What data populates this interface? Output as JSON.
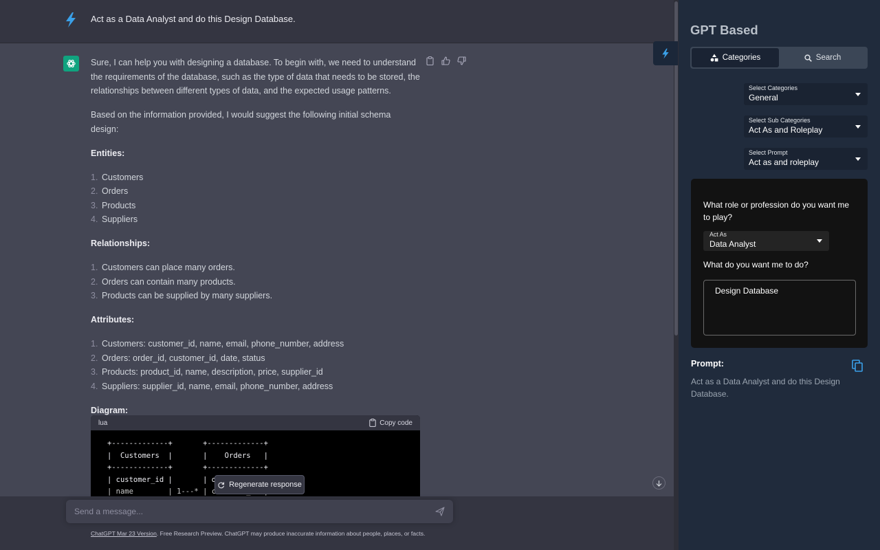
{
  "user_message": {
    "text": "Act as a Data Analyst and do this Design Database."
  },
  "assistant": {
    "intro": "Sure, I can help you with designing a database. To begin with, we need to understand the requirements of the database, such as the type of data that needs to be stored, the relationships between different types of data, and the expected usage patterns.",
    "suggestion": "Based on the information provided, I would suggest the following initial schema design:",
    "entities_heading": "Entities:",
    "entities": [
      {
        "num": "1.",
        "text": "Customers"
      },
      {
        "num": "2.",
        "text": "Orders"
      },
      {
        "num": "3.",
        "text": "Products"
      },
      {
        "num": "4.",
        "text": "Suppliers"
      }
    ],
    "relationships_heading": "Relationships:",
    "relationships": [
      {
        "num": "1.",
        "text": "Customers can place many orders."
      },
      {
        "num": "2.",
        "text": "Orders can contain many products."
      },
      {
        "num": "3.",
        "text": "Products can be supplied by many suppliers."
      }
    ],
    "attributes_heading": "Attributes:",
    "attributes": [
      {
        "num": "1.",
        "text": "Customers: customer_id, name, email, phone_number, address"
      },
      {
        "num": "2.",
        "text": "Orders: order_id, customer_id, date, status"
      },
      {
        "num": "3.",
        "text": "Products: product_id, name, description, price, supplier_id"
      },
      {
        "num": "4.",
        "text": "Suppliers: supplier_id, name, email, phone_number, address"
      }
    ],
    "diagram_heading": "Diagram:",
    "code": {
      "language": "lua",
      "copy_label": "Copy code",
      "lines": [
        "+-------------+       +-------------+",
        "|  Customers  |       |    Orders   |",
        "+-------------+       +-------------+",
        "| customer_id |       | o",
        "| name        | 1---* | customer_id |"
      ]
    }
  },
  "regenerate_label": "Regenerate response",
  "input": {
    "placeholder": "Send a message..."
  },
  "footer": {
    "link": "ChatGPT Mar 23 Version",
    "text": ". Free Research Preview. ChatGPT may produce inaccurate information about people, places, or facts."
  },
  "sidebar": {
    "title": "GPT Based",
    "tabs": [
      {
        "label": "Categories",
        "icon": "shapes-icon",
        "active": true
      },
      {
        "label": "Search",
        "icon": "search-icon",
        "active": false
      }
    ],
    "selects": [
      {
        "label": "Select Categories",
        "value": "General"
      },
      {
        "label": "Select Sub Categories",
        "value": "Act As and Roleplay"
      },
      {
        "label": "Select Prompt",
        "value": "Act as and roleplay"
      }
    ],
    "form": {
      "question1": "What role or profession do you want me to play?",
      "act_as_label": "Act As",
      "act_as_value": "Data Analyst",
      "question2": "What do you want me to do?",
      "task_value": "Design Database"
    },
    "prompt_label": "Prompt:",
    "prompt_text": "Act as a Data Analyst and do this Design Database."
  },
  "colors": {
    "accent_blue": "#3aa0e8",
    "gpt_green": "#10a37f",
    "sidebar_bg": "#202b3c"
  }
}
